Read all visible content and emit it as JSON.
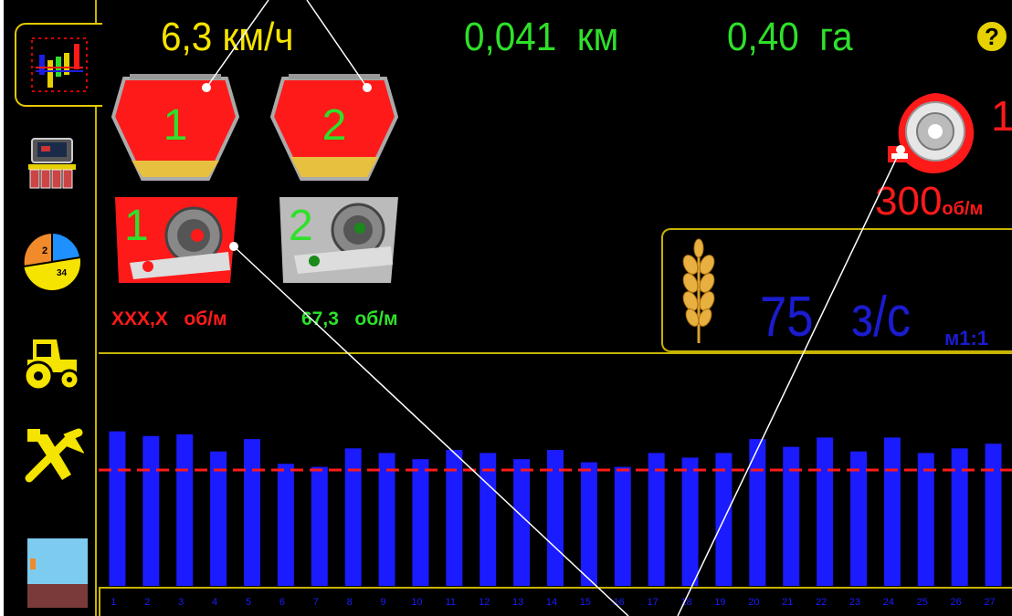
{
  "header": {
    "speed": "6,3",
    "speed_unit": "км/ч",
    "distance": "0,041",
    "distance_unit": "км",
    "area": "0,40",
    "area_unit": "га",
    "help_label": "?"
  },
  "sidebar": {
    "items": [
      {
        "name": "stats",
        "icon": "bar-chart-icon"
      },
      {
        "name": "seeder",
        "icon": "seeder-icon"
      },
      {
        "name": "pie",
        "icon": "pie-chart-icon",
        "labels": [
          "2",
          "34"
        ]
      },
      {
        "name": "tractor",
        "icon": "tractor-icon"
      },
      {
        "name": "settings",
        "icon": "wrench-screwdriver-icon"
      },
      {
        "name": "field",
        "icon": "field-icon"
      }
    ]
  },
  "hoppers": [
    {
      "number": "1",
      "color": "#ff1a1a"
    },
    {
      "number": "2",
      "color": "#ff1a1a"
    }
  ],
  "meters": [
    {
      "number": "1",
      "rpm": "XXX,X",
      "unit": "об/м",
      "color": "#ff1a1a"
    },
    {
      "number": "2",
      "rpm": "67,3",
      "unit": "об/м",
      "color": "#2fe02a"
    }
  ],
  "fan": {
    "number": "1",
    "rpm": "300",
    "unit": "об/м"
  },
  "seed": {
    "rate": "75",
    "unit": "з/с",
    "scale": "м1:1"
  },
  "colors": {
    "yellow": "#f5e300",
    "green": "#2fe02a",
    "red": "#ff1a1a",
    "blue": "#1b1bd0",
    "frame": "#c8b400"
  },
  "chart_data": {
    "type": "bar",
    "categories": [
      "1",
      "2",
      "3",
      "4",
      "5",
      "6",
      "7",
      "8",
      "9",
      "10",
      "11",
      "12",
      "13",
      "14",
      "15",
      "16",
      "17",
      "18",
      "19",
      "20",
      "21",
      "22",
      "23",
      "24",
      "25",
      "26",
      "27"
    ],
    "values": [
      100,
      97,
      98,
      87,
      95,
      79,
      77,
      89,
      86,
      82,
      88,
      86,
      82,
      88,
      80,
      77,
      86,
      83,
      86,
      95,
      90,
      96,
      87,
      96,
      86,
      89,
      92
    ],
    "reference": 75,
    "ylim": [
      0,
      150
    ]
  }
}
